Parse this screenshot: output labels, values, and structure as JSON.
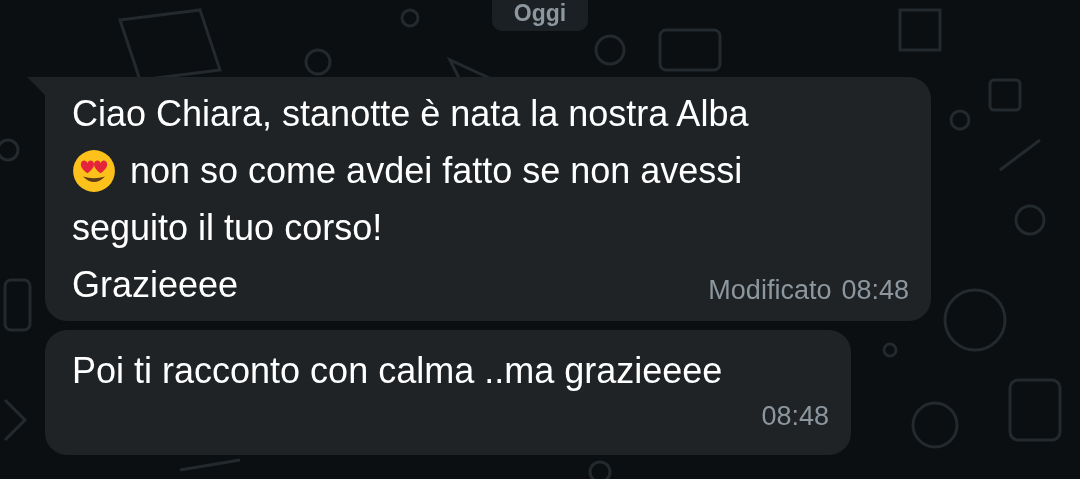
{
  "date_chip": "Oggi",
  "messages": [
    {
      "lines": [
        [
          {
            "kind": "text",
            "text": "Ciao Chiara, stanotte è nata la nostra Alba"
          }
        ],
        [
          {
            "kind": "emoji"
          },
          {
            "kind": "text",
            "text": "non so come avdei fatto se non avessi"
          }
        ],
        [
          {
            "kind": "text",
            "text": "seguito il tuo corso!"
          }
        ]
      ],
      "last_line": "Grazieeee",
      "tail": true,
      "edited_label": "Modificato",
      "time": "08:48"
    },
    {
      "last_line": "Poi ti racconto con calma ..ma grazieeee",
      "tail": false,
      "time": "08:48"
    }
  ]
}
